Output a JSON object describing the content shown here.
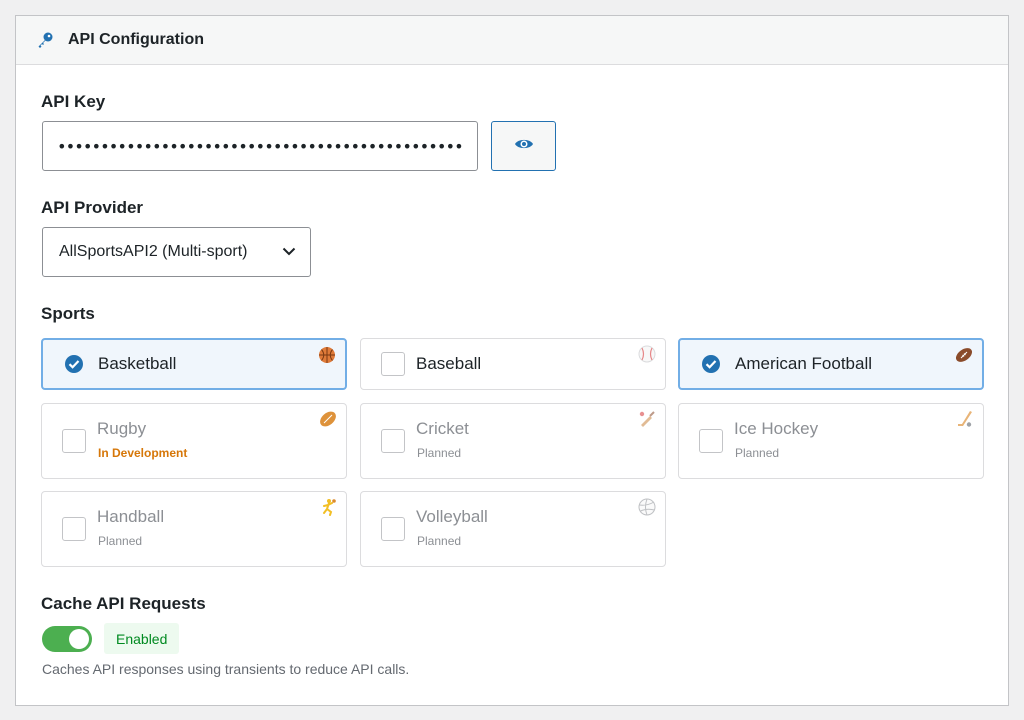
{
  "header": {
    "title": "API Configuration",
    "icon": "key-icon"
  },
  "api_key": {
    "label": "API Key",
    "value": "••••••••••••••••••••••••••••••••••••••••••••••••••••",
    "toggle_icon": "eye-icon"
  },
  "provider": {
    "label": "API Provider",
    "selected": "AllSportsAPI2 (Multi-sport)",
    "chevron_icon": "chevron-down-icon"
  },
  "sports": {
    "label": "Sports",
    "items": [
      {
        "name": "Basketball",
        "selected": true,
        "status": "",
        "icon": "basketball-icon"
      },
      {
        "name": "Baseball",
        "selected": false,
        "status": "",
        "icon": "baseball-icon"
      },
      {
        "name": "American Football",
        "selected": true,
        "status": "",
        "icon": "american-football-icon"
      },
      {
        "name": "Rugby",
        "selected": false,
        "status": "In Development",
        "icon": "rugby-ball-icon"
      },
      {
        "name": "Cricket",
        "selected": false,
        "status": "Planned",
        "icon": "cricket-bat-icon"
      },
      {
        "name": "Ice Hockey",
        "selected": false,
        "status": "Planned",
        "icon": "hockey-stick-icon"
      },
      {
        "name": "Handball",
        "selected": false,
        "status": "Planned",
        "icon": "handball-player-icon"
      },
      {
        "name": "Volleyball",
        "selected": false,
        "status": "Planned",
        "icon": "volleyball-icon"
      }
    ]
  },
  "cache": {
    "label": "Cache API Requests",
    "enabled": true,
    "badge": "Enabled",
    "help": "Caches API responses using transients to reduce API calls."
  },
  "colors": {
    "accent": "#2271b1",
    "check": "#2271b1",
    "toggle_on": "#4caf50",
    "dev_status": "#d67709",
    "enabled_text": "#008a20"
  }
}
